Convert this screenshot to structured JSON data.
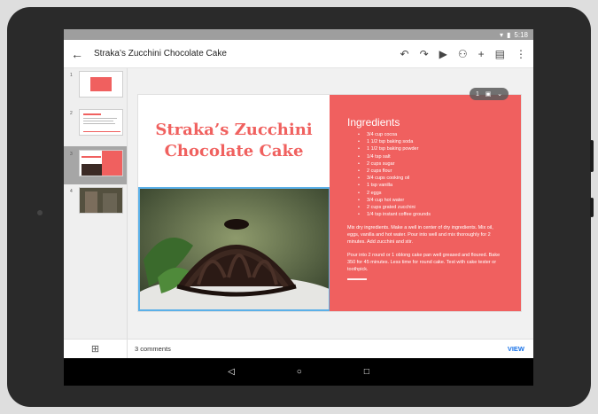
{
  "statusbar": {
    "time": "5:18",
    "wifi_icon": "wifi-icon",
    "battery_icon": "battery-icon"
  },
  "appbar": {
    "back_icon": "arrow-back-icon",
    "title": "Straka’s Zucchini Chocolate Cake",
    "tools": [
      "undo-icon",
      "redo-icon",
      "play-icon",
      "add-person-icon",
      "add-icon",
      "comment-icon",
      "more-vert-icon"
    ]
  },
  "filmstrip": {
    "slides": [
      {
        "number": "1"
      },
      {
        "number": "2"
      },
      {
        "number": "3",
        "selected": true
      },
      {
        "number": "4"
      }
    ]
  },
  "slide": {
    "title": "Straka’s Zucchini Chocolate Cake",
    "photo_badge": "Photo",
    "page_indicator": "1",
    "ingredients_heading": "Ingredients",
    "ingredients": [
      "3/4 cup cocoa",
      "1 1/2 tsp baking soda",
      "1 1/2 tsp baking powder",
      "1/4 tsp salt",
      "2 cups sugar",
      "2 cups flour",
      "3/4 cups cooking oil",
      "1 tsp vanilla",
      "2 eggs",
      "3/4 cup hot water",
      "2 cups grated zucchini",
      "1/4 tsp instant coffee grounds"
    ],
    "paragraph1": "Mix dry ingredients. Make a well in center of dry ingredients. Mix oil, eggs, vanilla and hot water. Pour into well and mix thoroughly for 2 minutes. Add zucchini and stir.",
    "paragraph2": "Pour into 2 round or 1 oblong cake pan well greased and floured. Bake 350 for 45 minutes. Less time for round cake. Test with cake tester or toothpick."
  },
  "bottombar": {
    "add_slide_icon": "add-slide-icon",
    "comments": "3 comments",
    "view": "VIEW"
  },
  "navbar": {
    "back": "◁",
    "home": "○",
    "recents": "□"
  },
  "colors": {
    "accent": "#f0605f",
    "selection": "#5bb0e8",
    "link": "#1a73e8"
  }
}
